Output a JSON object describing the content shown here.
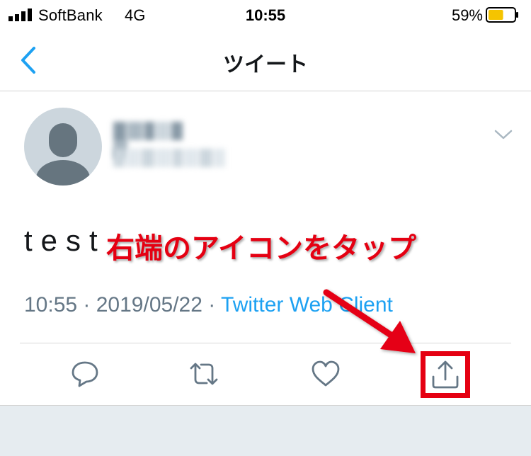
{
  "status_bar": {
    "carrier": "SoftBank",
    "network": "4G",
    "time": "10:55",
    "battery": "59%",
    "battery_level": 0.59,
    "battery_color": "#f5c400"
  },
  "nav": {
    "back_icon": "chevron-left-icon",
    "title": "ツイート"
  },
  "tweet": {
    "avatar_icon": "default-avatar-icon",
    "text": "test",
    "time": "10:55",
    "separator1": " · ",
    "date": "2019/05/22",
    "separator2": " · ",
    "source": "Twitter Web Client"
  },
  "actions": {
    "reply_icon": "reply-icon",
    "retweet_icon": "retweet-icon",
    "like_icon": "heart-icon",
    "share_icon": "share-icon"
  },
  "annotation": {
    "text": "右端のアイコンをタップ",
    "color": "#e50012"
  },
  "colors": {
    "accent": "#1da1f2",
    "secondary_text": "#657786",
    "highlight": "#e50012"
  }
}
